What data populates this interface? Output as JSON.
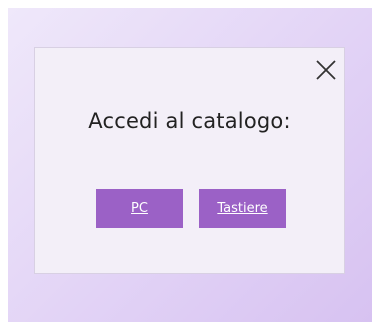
{
  "dialog": {
    "title": "Accedi al catalogo:",
    "close_icon": "close-icon",
    "buttons": [
      {
        "label": "PC"
      },
      {
        "label": "Tastiere"
      }
    ]
  },
  "colors": {
    "button_bg": "#9b61c6",
    "button_text": "#ffffff",
    "dialog_bg": "#f3eff8",
    "backdrop_start": "#efe8fa",
    "backdrop_end": "#d7c2f1"
  }
}
